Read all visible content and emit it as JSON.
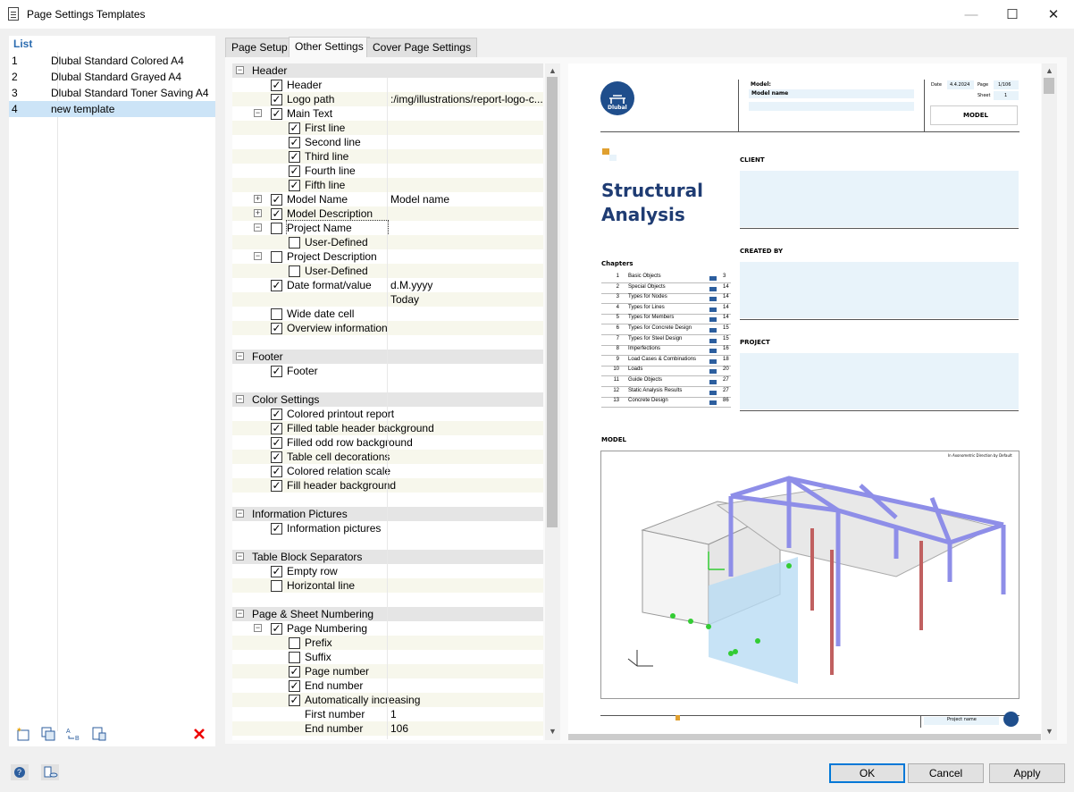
{
  "window": {
    "title": "Page Settings Templates"
  },
  "list": {
    "header": "List",
    "items": [
      {
        "num": "1",
        "name": "Dlubal Standard Colored A4"
      },
      {
        "num": "2",
        "name": "Dlubal Standard Grayed A4"
      },
      {
        "num": "3",
        "name": "Dlubal Standard Toner Saving A4"
      },
      {
        "num": "4",
        "name": "new template"
      }
    ]
  },
  "tabs": [
    "Page Setup",
    "Other Settings",
    "Cover Page Settings"
  ],
  "tree": [
    {
      "type": "section",
      "label": "Header"
    },
    {
      "label": "Header",
      "checked": true,
      "indent": 1
    },
    {
      "label": "Logo path",
      "checked": true,
      "indent": 1,
      "value": ":/img/illustrations/report-logo-c..."
    },
    {
      "label": "Main Text",
      "checked": true,
      "indent": 1,
      "expander": "−"
    },
    {
      "label": "First line",
      "checked": true,
      "indent": 2
    },
    {
      "label": "Second line",
      "checked": true,
      "indent": 2
    },
    {
      "label": "Third line",
      "checked": true,
      "indent": 2
    },
    {
      "label": "Fourth line",
      "checked": true,
      "indent": 2
    },
    {
      "label": "Fifth line",
      "checked": true,
      "indent": 2
    },
    {
      "label": "Model Name",
      "checked": true,
      "indent": 1,
      "expander": "+",
      "value": "Model name"
    },
    {
      "label": "Model Description",
      "checked": true,
      "indent": 1,
      "expander": "+"
    },
    {
      "label": "Project Name",
      "checked": false,
      "indent": 1,
      "expander": "−",
      "focused": true
    },
    {
      "label": "User-Defined",
      "checked": false,
      "indent": 2
    },
    {
      "label": "Project Description",
      "checked": false,
      "indent": 1,
      "expander": "−"
    },
    {
      "label": "User-Defined",
      "checked": false,
      "indent": 2
    },
    {
      "label": "Date format/value",
      "checked": true,
      "indent": 1,
      "value": "d.M.yyyy"
    },
    {
      "label": "",
      "indent": 1,
      "value": "Today",
      "nocb": true
    },
    {
      "label": "Wide date cell",
      "checked": false,
      "indent": 1
    },
    {
      "label": "Overview information",
      "checked": true,
      "indent": 1
    },
    {
      "type": "spacer"
    },
    {
      "type": "section",
      "label": "Footer"
    },
    {
      "label": "Footer",
      "checked": true,
      "indent": 1
    },
    {
      "type": "spacer"
    },
    {
      "type": "section",
      "label": "Color Settings"
    },
    {
      "label": "Colored printout report",
      "checked": true,
      "indent": 1
    },
    {
      "label": "Filled table header background",
      "checked": true,
      "indent": 1
    },
    {
      "label": "Filled odd row background",
      "checked": true,
      "indent": 1
    },
    {
      "label": "Table cell decorations",
      "checked": true,
      "indent": 1
    },
    {
      "label": "Colored relation scale",
      "checked": true,
      "indent": 1
    },
    {
      "label": "Fill header background",
      "checked": true,
      "indent": 1
    },
    {
      "type": "spacer"
    },
    {
      "type": "section",
      "label": "Information Pictures"
    },
    {
      "label": "Information pictures",
      "checked": true,
      "indent": 1
    },
    {
      "type": "spacer"
    },
    {
      "type": "section",
      "label": "Table Block Separators"
    },
    {
      "label": "Empty row",
      "checked": true,
      "indent": 1
    },
    {
      "label": "Horizontal line",
      "checked": false,
      "indent": 1
    },
    {
      "type": "spacer"
    },
    {
      "type": "section",
      "label": "Page & Sheet Numbering"
    },
    {
      "label": "Page Numbering",
      "checked": true,
      "indent": 1,
      "expander": "−"
    },
    {
      "label": "Prefix",
      "checked": false,
      "indent": 2
    },
    {
      "label": "Suffix",
      "checked": false,
      "indent": 2
    },
    {
      "label": "Page number",
      "checked": true,
      "indent": 2
    },
    {
      "label": "End number",
      "checked": true,
      "indent": 2
    },
    {
      "label": "Automatically increasing",
      "checked": true,
      "indent": 2
    },
    {
      "label": "First number",
      "indent": 2,
      "nocb": true,
      "value": "1"
    },
    {
      "label": "End number",
      "indent": 2,
      "nocb": true,
      "value": "106"
    }
  ],
  "preview": {
    "logo": "Dlubal",
    "model_label": "Model:",
    "model_name": "Model name",
    "date_label": "Date",
    "date_value": "4.4.2024",
    "page_label": "Page",
    "page_value": "1/106",
    "sheet_label": "Sheet",
    "sheet_value": "1",
    "header_box": "MODEL",
    "title_line1": "Structural",
    "title_line2": "Analysis",
    "client": "CLIENT",
    "created_by": "CREATED BY",
    "project": "PROJECT",
    "chapters_label": "Chapters",
    "chapters": [
      {
        "n": "1",
        "t": "Basic Objects",
        "p": "3"
      },
      {
        "n": "2",
        "t": "Special Objects",
        "p": "14"
      },
      {
        "n": "3",
        "t": "Types for Nodes",
        "p": "14"
      },
      {
        "n": "4",
        "t": "Types for Lines",
        "p": "14"
      },
      {
        "n": "5",
        "t": "Types for Members",
        "p": "14"
      },
      {
        "n": "6",
        "t": "Types for Concrete Design",
        "p": "15"
      },
      {
        "n": "7",
        "t": "Types for Steel Design",
        "p": "15"
      },
      {
        "n": "8",
        "t": "Imperfections",
        "p": "16"
      },
      {
        "n": "9",
        "t": "Load Cases & Combinations",
        "p": "18"
      },
      {
        "n": "10",
        "t": "Loads",
        "p": "20"
      },
      {
        "n": "11",
        "t": "Guide Objects",
        "p": "27"
      },
      {
        "n": "12",
        "t": "Static Analysis Results",
        "p": "27"
      },
      {
        "n": "13",
        "t": "Concrete Design",
        "p": "86"
      }
    ],
    "model_section": "MODEL",
    "model_caption": "In Axonometric Direction by Default",
    "footer_project": "Project name"
  },
  "buttons": {
    "ok": "OK",
    "cancel": "Cancel",
    "apply": "Apply"
  }
}
